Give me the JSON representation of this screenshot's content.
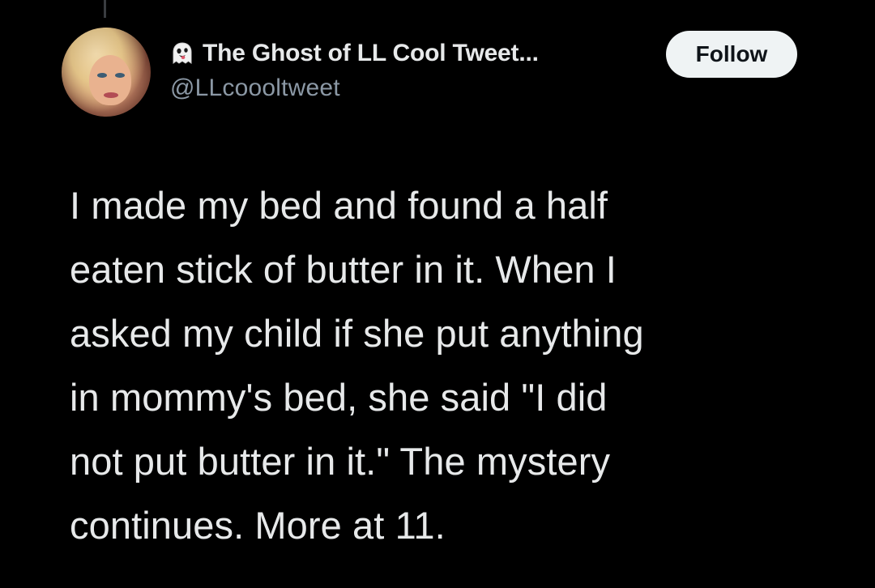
{
  "tweet": {
    "author": {
      "display_name": "The Ghost of LL Cool Tweet...",
      "handle": "@LLcoooltweet",
      "name_icon": "ghost-emoji-icon",
      "avatar": "profile-avatar"
    },
    "follow_label": "Follow",
    "text": "I made my bed and found a half\neaten stick of butter in it. When I\nasked my child if she put anything\nin mommy's bed, she said \"I did\nnot put butter in it.\" The mystery\ncontinues. More at 11."
  },
  "colors": {
    "background": "#000000",
    "text_primary": "#e7e9ea",
    "text_secondary": "#8b98a5",
    "follow_button_bg": "#eff3f4",
    "follow_button_text": "#0f1419",
    "thread_line": "#3a3d41"
  }
}
